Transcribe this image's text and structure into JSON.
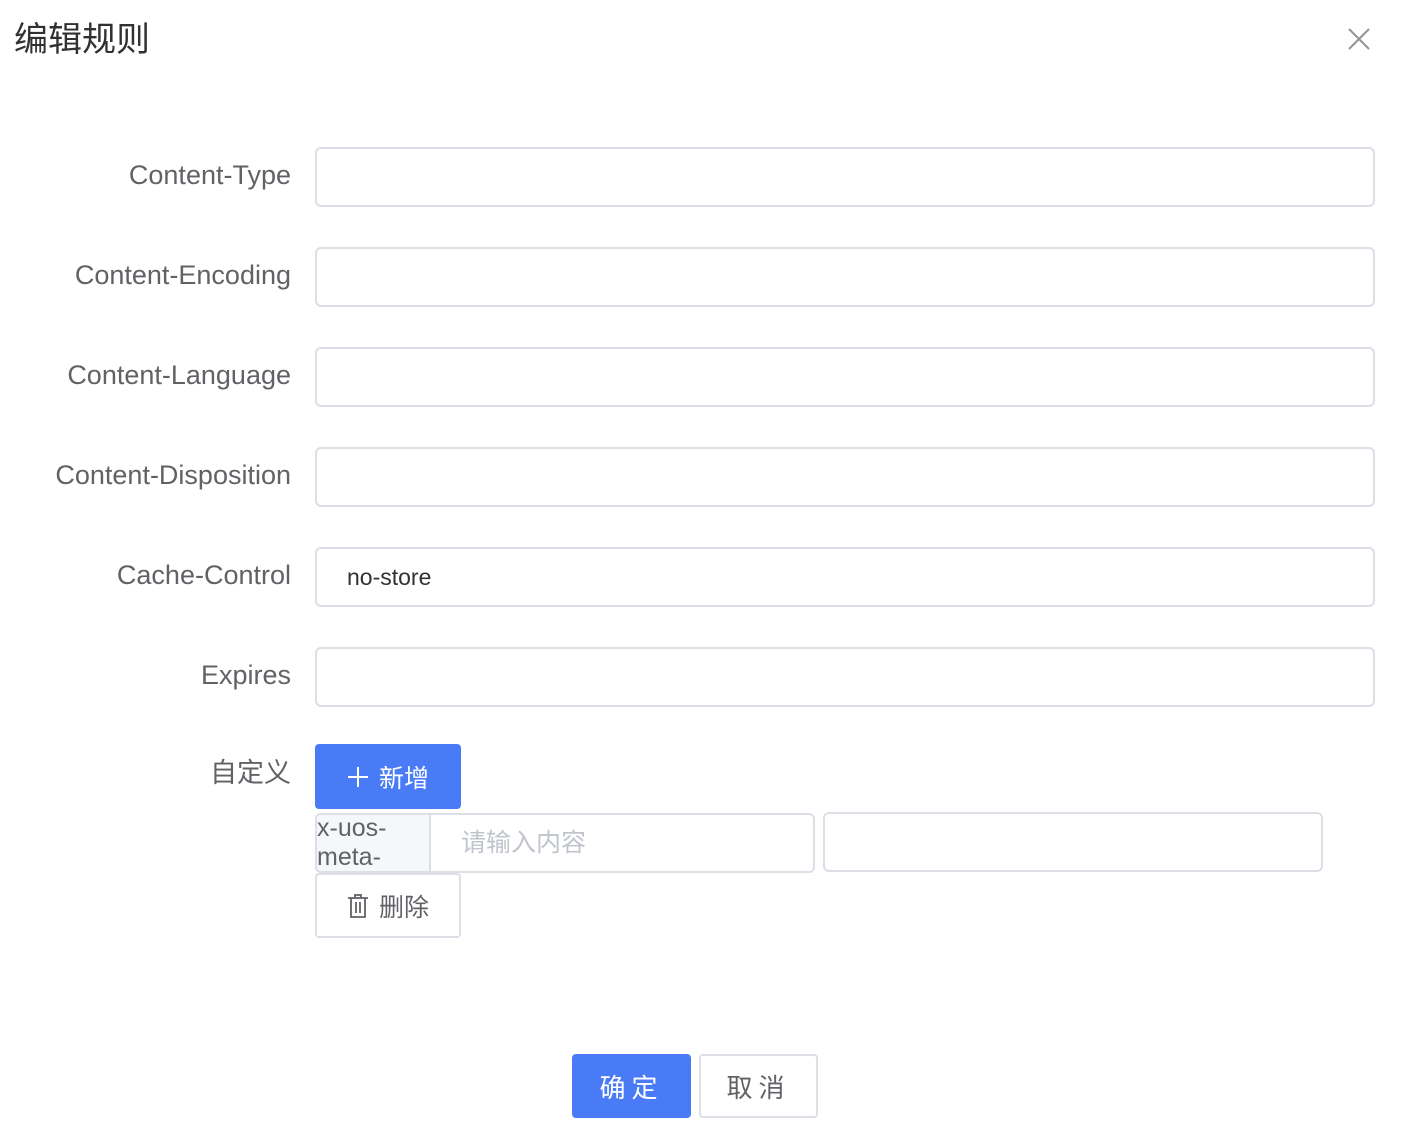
{
  "dialog": {
    "title": "编辑规则",
    "close_icon": "close-icon"
  },
  "form": {
    "fields": [
      {
        "label": "Content-Type",
        "value": ""
      },
      {
        "label": "Content-Encoding",
        "value": ""
      },
      {
        "label": "Content-Language",
        "value": ""
      },
      {
        "label": "Content-Disposition",
        "value": ""
      },
      {
        "label": "Cache-Control",
        "value": "no-store"
      },
      {
        "label": "Expires",
        "value": ""
      }
    ],
    "custom": {
      "label": "自定义",
      "add_button": {
        "icon": "plus-icon",
        "label": "新增"
      },
      "meta_prefix": "x-uos-meta-",
      "key_placeholder": "请输入内容",
      "value": "",
      "delete_button": {
        "icon": "trash-icon",
        "label": "删除"
      }
    }
  },
  "footer": {
    "confirm_label": "确定",
    "cancel_label": "取消"
  },
  "colors": {
    "primary": "#4a7bf7",
    "border": "#dcdfe6",
    "label_text": "#606266",
    "placeholder": "#c0c4cc"
  }
}
